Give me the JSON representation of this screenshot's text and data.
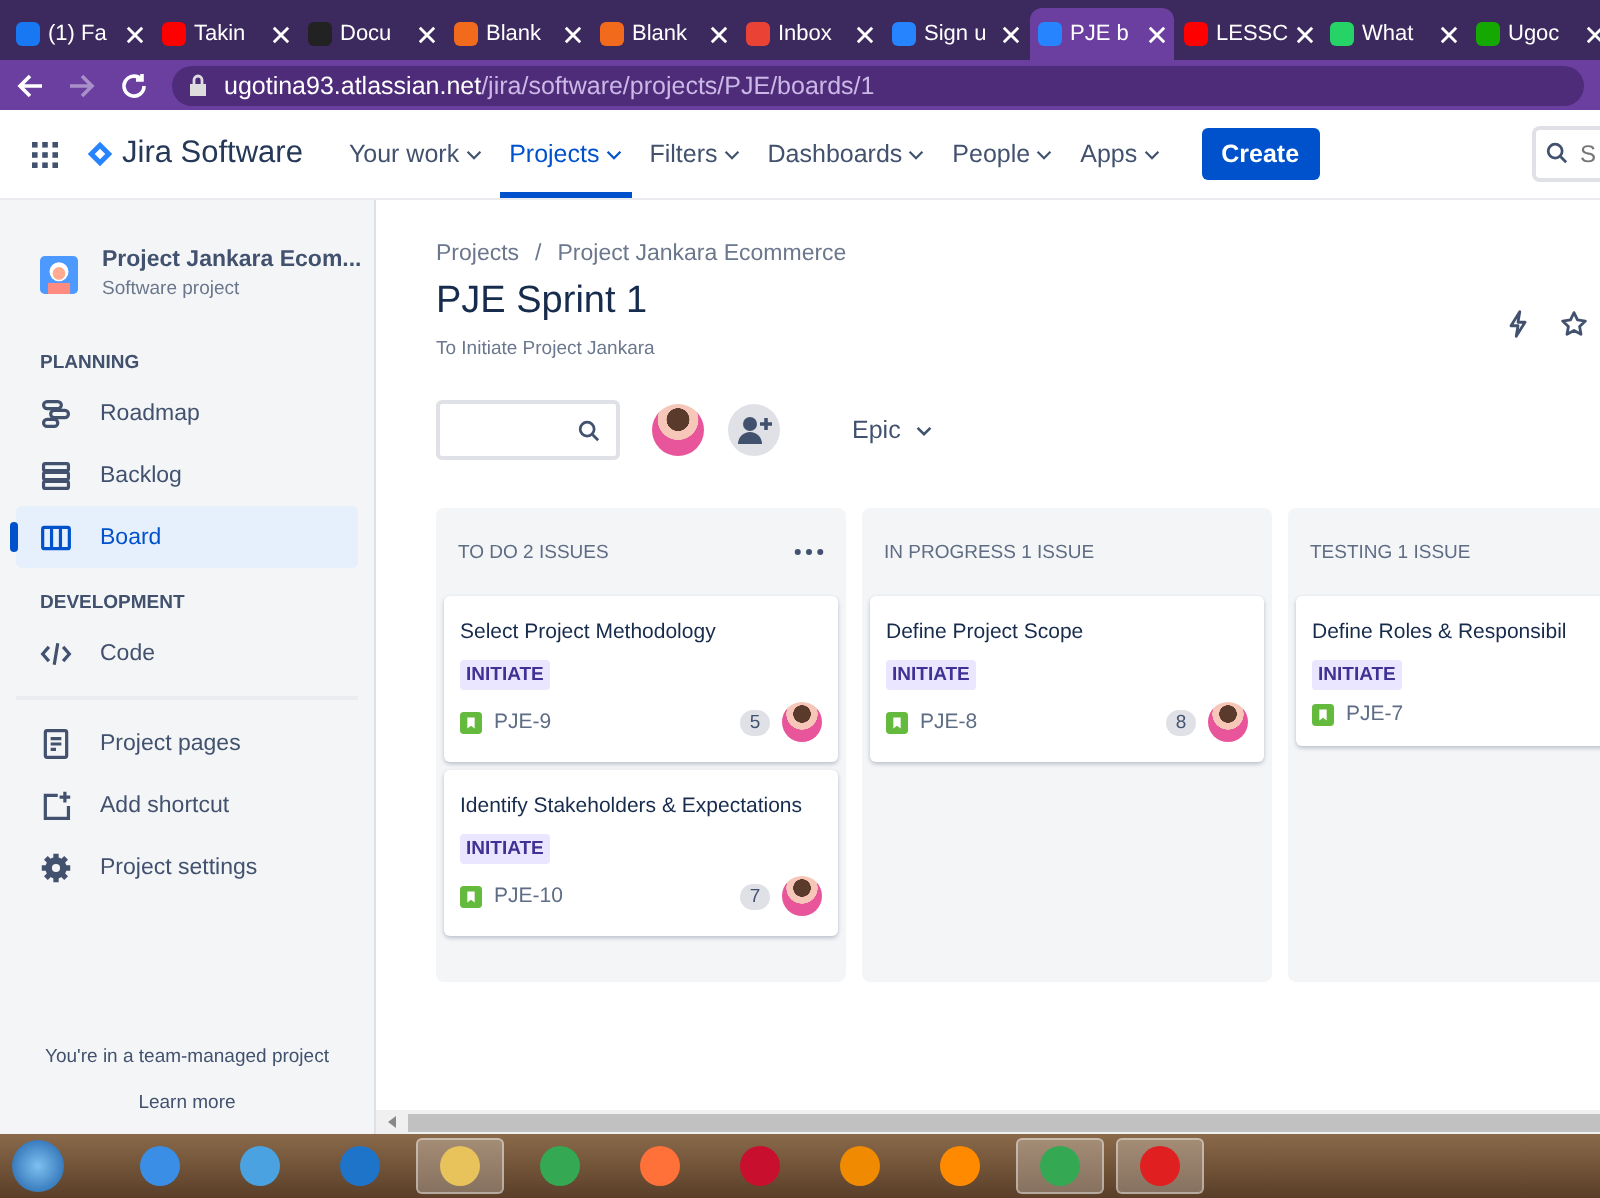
{
  "browser": {
    "tabs": [
      {
        "label": "(1) Fa",
        "color": "#1877f2",
        "selected": false
      },
      {
        "label": "Takin",
        "color": "#ff0000",
        "selected": false
      },
      {
        "label": "Docu",
        "color": "#222222",
        "selected": false
      },
      {
        "label": "Blank",
        "color": "#f26b1d",
        "selected": false
      },
      {
        "label": "Blank",
        "color": "#f26b1d",
        "selected": false
      },
      {
        "label": "Inbox",
        "color": "#ea4335",
        "selected": false
      },
      {
        "label": "Sign u",
        "color": "#2684ff",
        "selected": false
      },
      {
        "label": "PJE b",
        "color": "#2684ff",
        "selected": true
      },
      {
        "label": "LESSC",
        "color": "#ff0000",
        "selected": false
      },
      {
        "label": "What",
        "color": "#25d366",
        "selected": false
      },
      {
        "label": "Ugoc",
        "color": "#14a800",
        "selected": false
      }
    ],
    "url_host": "ugotina93.atlassian.net",
    "url_path": "/jira/software/projects/PJE/boards/1"
  },
  "topnav": {
    "product": "Jira Software",
    "items": [
      {
        "label": "Your work",
        "selected": false
      },
      {
        "label": "Projects",
        "selected": true
      },
      {
        "label": "Filters",
        "selected": false
      },
      {
        "label": "Dashboards",
        "selected": false
      },
      {
        "label": "People",
        "selected": false
      },
      {
        "label": "Apps",
        "selected": false
      }
    ],
    "create": "Create",
    "search_placeholder": "S"
  },
  "sidebar": {
    "project_name": "Project Jankara Ecom...",
    "project_type": "Software project",
    "sections": [
      {
        "heading": "PLANNING",
        "items": [
          {
            "label": "Roadmap",
            "kind": "roadmap",
            "selected": false
          },
          {
            "label": "Backlog",
            "kind": "backlog",
            "selected": false
          },
          {
            "label": "Board",
            "kind": "board",
            "selected": true
          }
        ]
      },
      {
        "heading": "DEVELOPMENT",
        "items": [
          {
            "label": "Code",
            "kind": "code",
            "selected": false
          }
        ]
      }
    ],
    "extra_items": [
      {
        "label": "Project pages",
        "kind": "pages"
      },
      {
        "label": "Add shortcut",
        "kind": "shortcut"
      },
      {
        "label": "Project settings",
        "kind": "settings"
      }
    ],
    "footer": "You're in a team-managed project",
    "learn_more": "Learn more"
  },
  "board": {
    "breadcrumbs": [
      "Projects",
      "Project Jankara Ecommerce"
    ],
    "breadcrumb_separator": "/",
    "title": "PJE Sprint 1",
    "subtitle": "To Initiate Project Jankara",
    "epic_filter": "Epic",
    "columns": [
      {
        "title": "TO DO 2 ISSUES",
        "menu": true,
        "cards": [
          {
            "title": "Select Project Methodology",
            "label": "INITIATE",
            "key": "PJE-9",
            "points": "5",
            "assigned": true
          },
          {
            "title": "Identify Stakeholders & Expectations",
            "label": "INITIATE",
            "key": "PJE-10",
            "points": "7",
            "assigned": true
          }
        ]
      },
      {
        "title": "IN PROGRESS 1 ISSUE",
        "menu": false,
        "cards": [
          {
            "title": "Define Project Scope",
            "label": "INITIATE",
            "key": "PJE-8",
            "points": "8",
            "assigned": true
          }
        ]
      },
      {
        "title": "TESTING 1 ISSUE",
        "menu": false,
        "cards": [
          {
            "title": "Define Roles & Responsibil",
            "label": "INITIATE",
            "key": "PJE-7",
            "assigned": false
          }
        ]
      }
    ]
  },
  "taskbar": [
    {
      "color": "#3a8ee6",
      "running": false
    },
    {
      "color": "#4aa3e0",
      "running": false
    },
    {
      "color": "#1e74c8",
      "running": false
    },
    {
      "color": "#e8c25a",
      "running": true
    },
    {
      "color": "#34a853",
      "running": false
    },
    {
      "color": "#ff7139",
      "running": false
    },
    {
      "color": "#c8102e",
      "running": false
    },
    {
      "color": "#f08a00",
      "running": false
    },
    {
      "color": "#ff8a00",
      "running": false
    },
    {
      "color": "#34a853",
      "running": true
    },
    {
      "color": "#e02020",
      "running": true
    }
  ]
}
